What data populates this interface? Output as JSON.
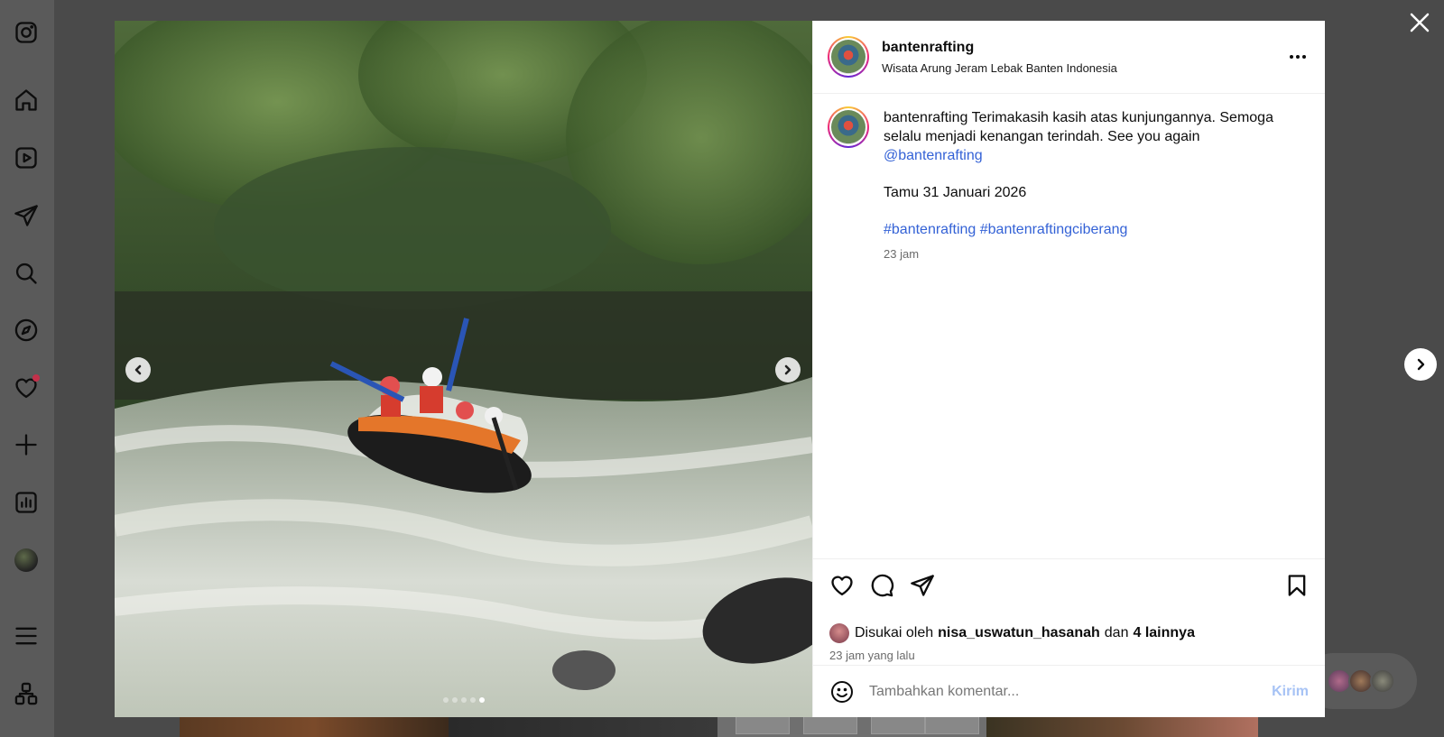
{
  "sidebar": {
    "items": [
      {
        "icon": "instagram-logo-icon"
      },
      {
        "icon": "home-icon"
      },
      {
        "icon": "reels-icon"
      },
      {
        "icon": "messages-icon"
      },
      {
        "icon": "search-icon"
      },
      {
        "icon": "explore-icon"
      },
      {
        "icon": "notifications-heart-icon",
        "has_dot": true
      },
      {
        "icon": "create-plus-icon"
      },
      {
        "icon": "dashboard-icon"
      },
      {
        "icon": "profile-avatar"
      },
      {
        "icon": "menu-icon"
      },
      {
        "icon": "also-from-meta-icon"
      }
    ]
  },
  "post": {
    "username": "bantenrafting",
    "location": "Wisata Arung Jeram Lebak Banten Indonesia",
    "caption": {
      "username": "bantenrafting",
      "text": "Terimakasih kasih atas kunjungannya. Semoga selalu menjadi kenangan terindah. See you again",
      "mention": "@bantenrafting",
      "guest_line": "Tamu 31 Januari 2026",
      "hashtags": "#bantenrafting #bantenraftingciberang",
      "time": "23 jam"
    },
    "likes": {
      "prefix": "Disukai oleh",
      "liker": "nisa_uswatun_hasanah",
      "joiner": "dan",
      "others": "4 lainnya"
    },
    "time_ago": "23 jam yang lalu",
    "comment_placeholder": "Tambahkan komentar...",
    "send_label": "Kirim",
    "carousel": {
      "count": 5,
      "active_index": 4
    }
  },
  "colors": {
    "link": "#3462d6",
    "send_disabled": "#a7c3f5",
    "notification_dot": "#c3304a"
  }
}
